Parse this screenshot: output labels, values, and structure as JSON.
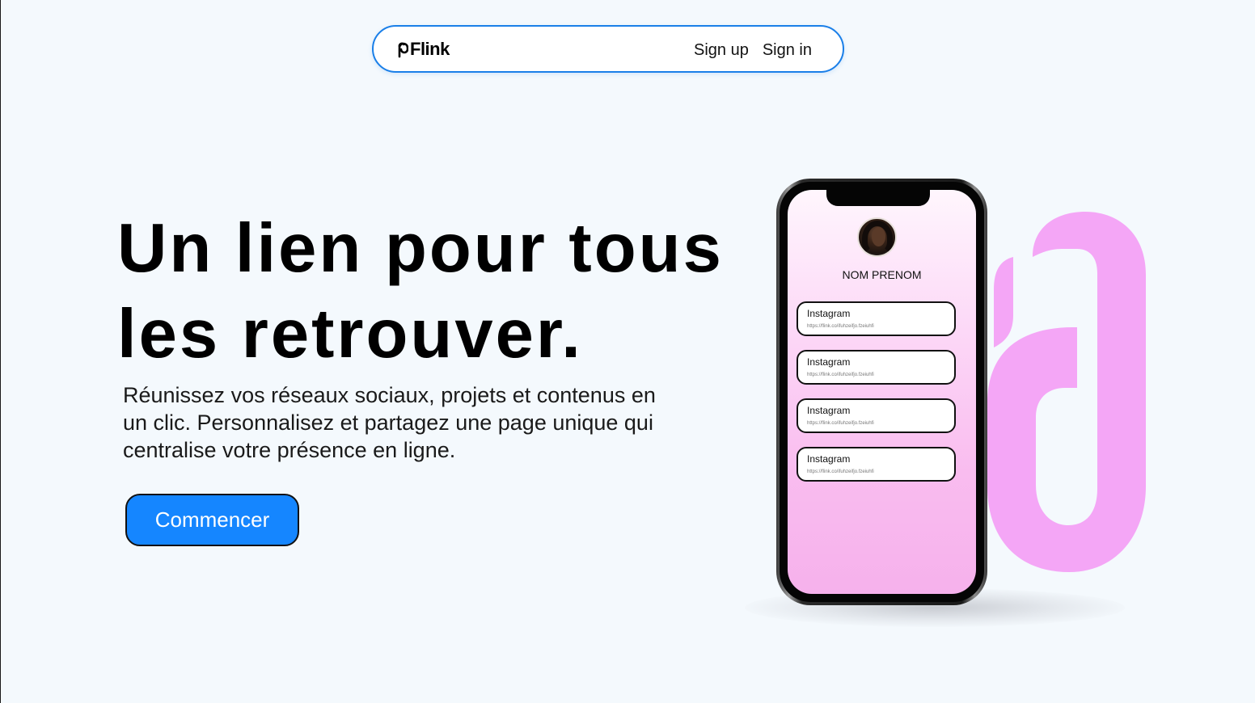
{
  "navbar": {
    "brand": "Flink",
    "links": [
      "Sign up",
      "Sign in"
    ],
    "accent": "#1a7fe8"
  },
  "hero": {
    "title_lines": [
      "Un lien pour tous",
      "les retrouver."
    ],
    "description": "Réunissez vos réseaux sociaux, projets et contenus en un clic. Personnalisez et partagez une page unique qui centralise votre présence en ligne.",
    "cta_label": "Commencer",
    "cta_color": "#1586ff"
  },
  "phone": {
    "profile_name": "NOM PRENOM",
    "links": [
      {
        "label": "Instagram",
        "url": "https://flink.co/ifuhzeifjo.fzeiuhfi"
      },
      {
        "label": "Instagram",
        "url": "https://flink.co/ifuhzeifjo.fzeiuhfi"
      },
      {
        "label": "Instagram",
        "url": "https://flink.co/ifuhzeifjo.fzeiuhfi"
      },
      {
        "label": "Instagram",
        "url": "https://flink.co/ifuhzeifjo.fzeiuhfi"
      }
    ],
    "screen_gradient": [
      "#fff6fd",
      "#f6b1ec"
    ]
  },
  "decor": {
    "link_icon_color": "#f4a6f6"
  }
}
